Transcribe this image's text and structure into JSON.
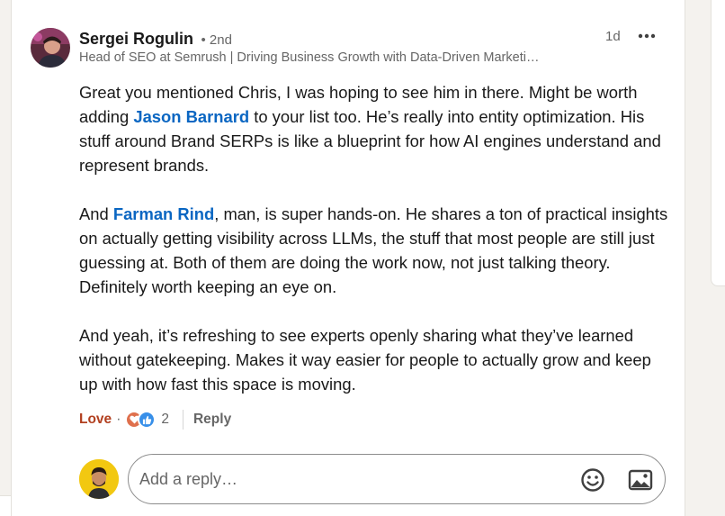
{
  "comment": {
    "author_name": "Sergei Rogulin",
    "connection_degree": "• 2nd",
    "headline": "Head of SEO at Semrush | Driving Business Growth with Data-Driven Marketi…",
    "timestamp": "1d",
    "more_icon": "more-horizontal-icon",
    "paragraph1": {
      "part1": "Great you mentioned Chris, I was hoping to see him in there. Might be worth adding ",
      "mention": "Jason Barnard",
      "part2": " to your list too. He’s really into entity optimization. His stuff around Brand SERPs is like a blueprint for how AI engines understand and represent brands."
    },
    "paragraph2": {
      "part1": "And ",
      "mention": "Farman Rind",
      "part2": ", man, is super hands-on. He shares a ton of practical insights on actually getting visibility across LLMs, the stuff that most people are still just guessing at. Both of them are doing the work now, not just talking theory. Definitely worth keeping an eye on."
    },
    "paragraph3": "And yeah, it’s refreshing to see experts openly sharing what they’ve learned without gatekeeping. Makes it way easier for people to actually grow and keep up with how fast this space is moving."
  },
  "actions": {
    "reaction_label": "Love",
    "separator": "·",
    "reaction_count": "2",
    "reply_label": "Reply"
  },
  "reply": {
    "placeholder": "Add a reply…",
    "emoji_icon": "emoji-smile-icon",
    "image_icon": "image-icon"
  },
  "colors": {
    "mention": "#0a66c2",
    "love": "#b24020",
    "like": "#378fe9"
  }
}
